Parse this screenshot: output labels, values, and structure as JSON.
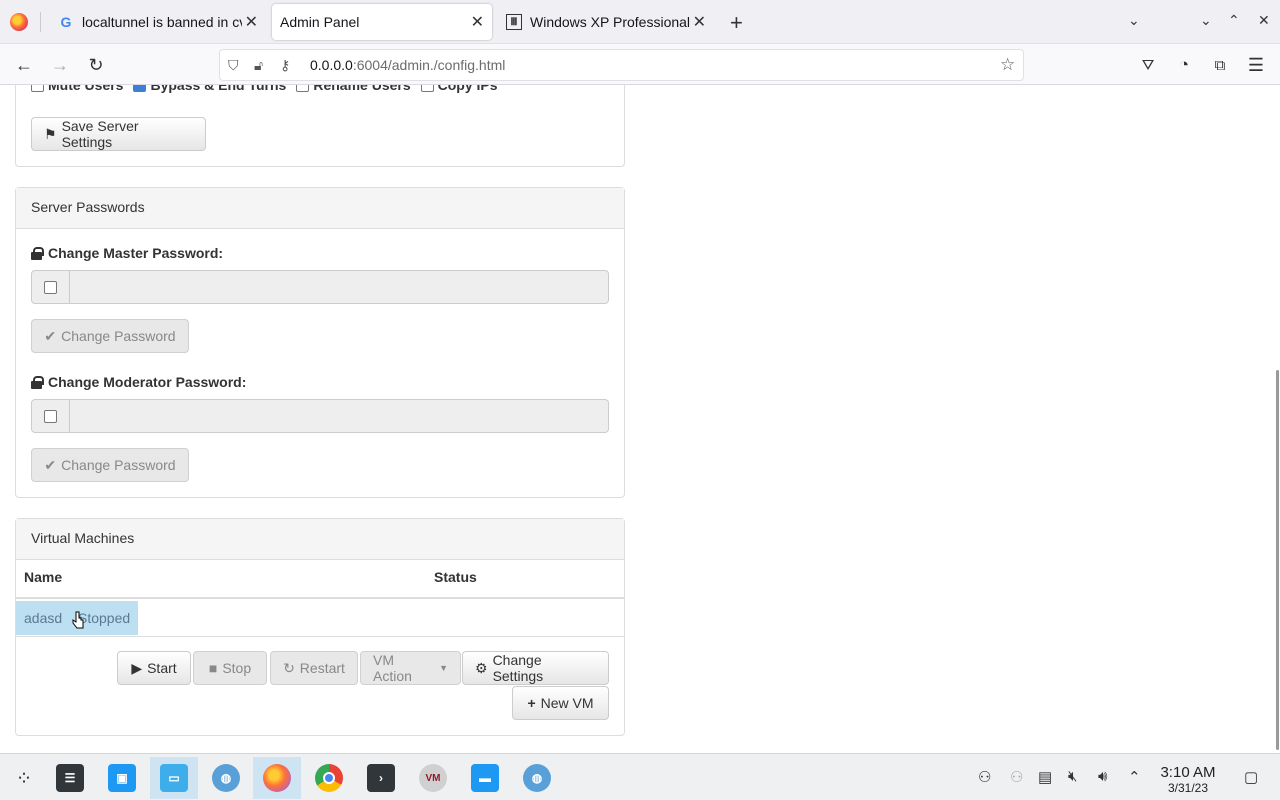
{
  "browser": {
    "tabs": [
      {
        "title": "localtunnel is banned in cv",
        "favicon": "google-icon"
      },
      {
        "title": "Admin Panel",
        "favicon": "none"
      },
      {
        "title": "Windows XP Professional",
        "favicon": "archive-icon"
      }
    ],
    "url_host": "0.0.0.0",
    "url_path": ":6004/admin./config.html"
  },
  "server_settings": {
    "checkboxes": [
      {
        "label": "Mute Users",
        "checked": false
      },
      {
        "label": "Bypass & End Turns",
        "checked": true
      },
      {
        "label": "Rename Users",
        "checked": false
      },
      {
        "label": "Copy IPs",
        "checked": false
      }
    ],
    "save_label": "Save Server Settings"
  },
  "server_passwords": {
    "heading": "Server Passwords",
    "master_label": "Change Master Password:",
    "master_button": "Change Password",
    "moderator_label": "Change Moderator Password:",
    "moderator_button": "Change Password"
  },
  "virtual_machines": {
    "heading": "Virtual Machines",
    "columns": [
      "Name",
      "Status"
    ],
    "rows": [
      {
        "name": "adasd",
        "status": "Stopped"
      }
    ],
    "actions": {
      "start": "Start",
      "stop": "Stop",
      "restart": "Restart",
      "vm_action": "VM Action",
      "change_settings": "Change Settings",
      "new_vm": "New VM"
    }
  },
  "taskbar": {
    "time": "3:10 AM",
    "date": "3/31/23"
  },
  "colors": {
    "selected_row": "#bcdff1",
    "panel_heading": "#f5f5f5",
    "accent_checkbox": "#3d7fd6"
  }
}
